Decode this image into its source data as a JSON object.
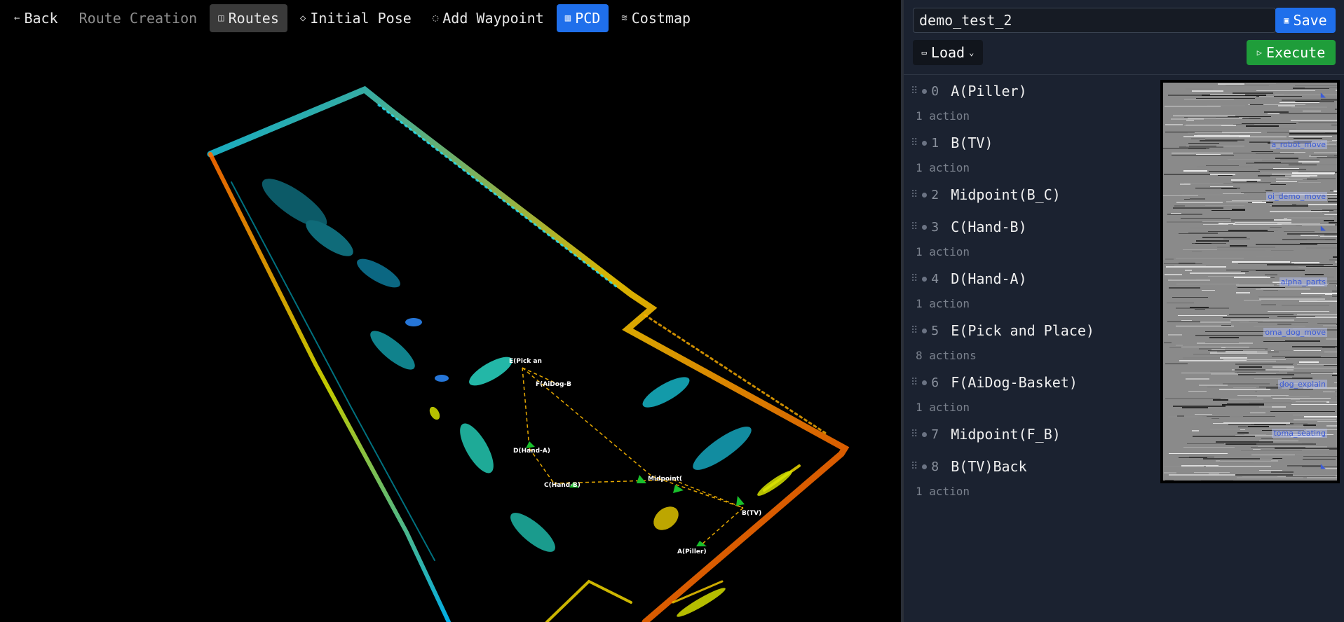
{
  "toolbar": {
    "back": "Back",
    "route_creation": "Route Creation",
    "routes": "Routes",
    "initial_pose": "Initial Pose",
    "add_waypoint": "Add Waypoint",
    "pcd": "PCD",
    "costmap": "Costmap"
  },
  "panel": {
    "route_name": "demo_test_2",
    "save": "Save",
    "load": "Load",
    "execute": "Execute"
  },
  "waypoints": [
    {
      "index": "0",
      "name": "A(Piller)",
      "actions": "1 action"
    },
    {
      "index": "1",
      "name": "B(TV)",
      "actions": "1 action"
    },
    {
      "index": "2",
      "name": "Midpoint(B_C)",
      "actions": ""
    },
    {
      "index": "3",
      "name": "C(Hand-B)",
      "actions": "1 action"
    },
    {
      "index": "4",
      "name": "D(Hand-A)",
      "actions": "1 action"
    },
    {
      "index": "5",
      "name": "E(Pick and Place)",
      "actions": "8 actions"
    },
    {
      "index": "6",
      "name": "F(AiDog-Basket)",
      "actions": "1 action"
    },
    {
      "index": "7",
      "name": "Midpoint(F_B)",
      "actions": ""
    },
    {
      "index": "8",
      "name": "B(TV)Back",
      "actions": "1 action"
    }
  ],
  "map_labels": {
    "pick": "E(Pick an",
    "aidog": "F(AiDog-B",
    "hand_a": "D(Hand-A)",
    "hand_b": "C(Hand-B)",
    "midpoint": "Midpoint(",
    "tv": "B(TV)",
    "piller": "A(Piller)"
  },
  "thumbnail_labels": [
    "a_robot_move",
    "oi_demo_move",
    "alpha_parts",
    "oma_dog_move",
    "dog_explain",
    "toma_seating"
  ],
  "colors": {
    "blue": "#1f6feb",
    "green": "#1f9d3a",
    "panel": "#1b2230"
  }
}
